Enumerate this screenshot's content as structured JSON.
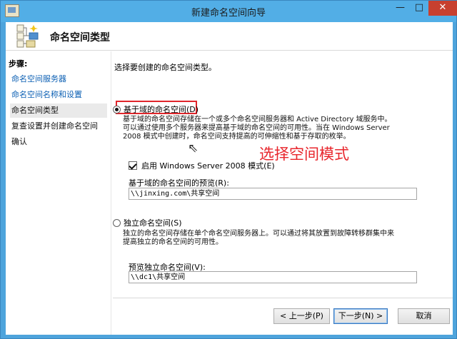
{
  "window": {
    "title": "新建命名空间向导",
    "controls": {
      "minimize": "—",
      "maximize": "□",
      "close": "✕"
    }
  },
  "header": {
    "title": "命名空间类型",
    "icon": "wizard-tree-icon"
  },
  "sidebar": {
    "heading": "步骤:",
    "items": [
      {
        "label": "命名空间服务器",
        "state": "link"
      },
      {
        "label": "命名空间名称和设置",
        "state": "link"
      },
      {
        "label": "命名空间类型",
        "state": "current"
      },
      {
        "label": "复查设置并创建命名空间",
        "state": "plain"
      },
      {
        "label": "确认",
        "state": "plain"
      }
    ]
  },
  "content": {
    "intro": "选择要创建的命名空间类型。",
    "domain_option": {
      "label": "基于域的命名空间(D)",
      "checked": true,
      "description_line1": "基于域的命名空间存储在一个或多个命名空间服务器和 Active Directory 域服务中。",
      "description_line2": "可以通过使用多个服务器来提高基于域的命名空间的可用性。当在 Windows Server",
      "description_line3": "2008 模式中创建时，命名空间支持提高的可伸缩性和基于存取的枚举。",
      "ws2008_mode_label": "启用 Windows Server 2008 模式(E)",
      "ws2008_mode_checked": true,
      "preview_label": "基于域的命名空间的预览(R):",
      "preview_value": "\\\\jinxing.com\\共享空间"
    },
    "standalone_option": {
      "label": "独立命名空间(S)",
      "checked": false,
      "description_line1": "独立的命名空间存储在单个命名空间服务器上。可以通过将其放置到故障转移群集中来",
      "description_line2": "提高独立的命名空间的可用性。",
      "preview_label": "预览独立命名空间(V):",
      "preview_value": "\\\\dc1\\共享空间"
    },
    "annotation": "选择空间模式",
    "annotation_color": "#e8262c"
  },
  "buttons": {
    "prev": "< 上一步(P)",
    "next": "下一步(N) >",
    "cancel": "取消"
  }
}
